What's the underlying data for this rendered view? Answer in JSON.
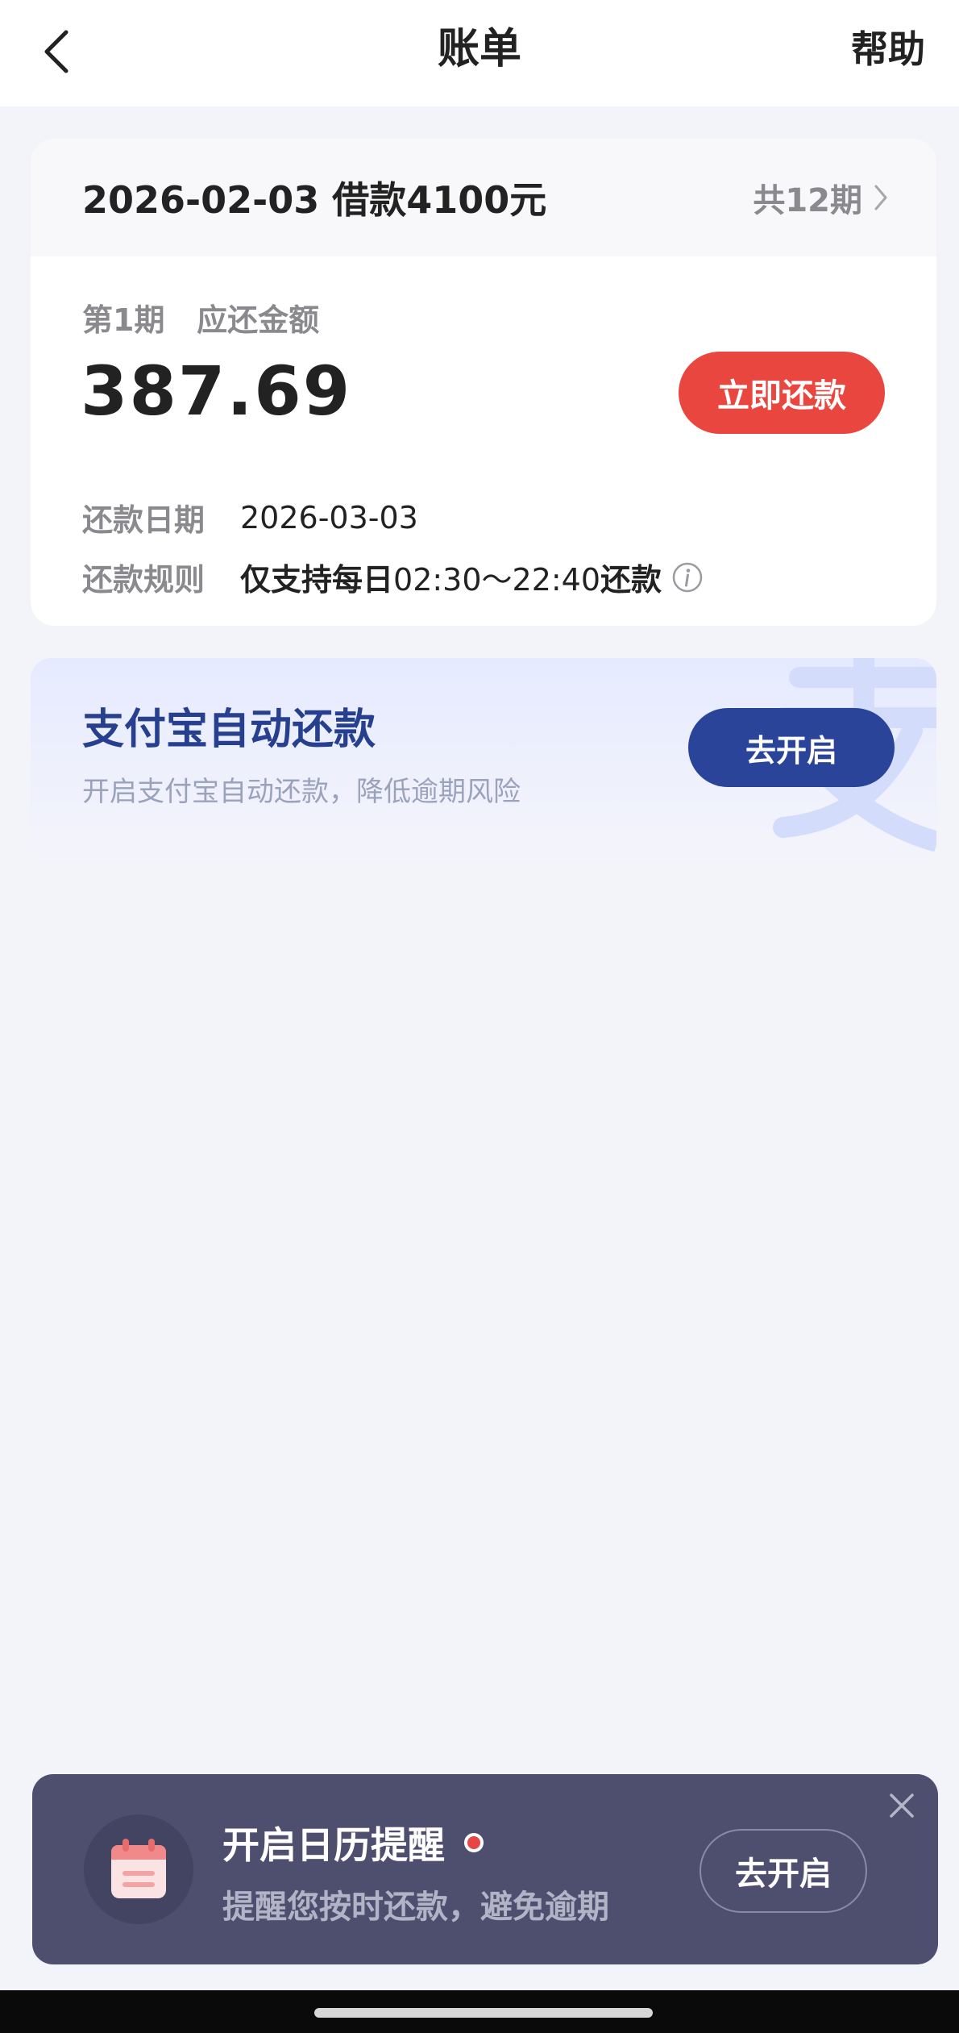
{
  "header": {
    "title": "账单",
    "help_label": "帮助",
    "back_icon": "chevron-left-icon"
  },
  "loan": {
    "summary": "2026-02-03 借款4100元",
    "periods_label": "共12期",
    "period_label": "第1期   应还金额",
    "amount": "387.69",
    "repay_button": "立即还款",
    "date_label": "还款日期",
    "date_value": "2026-03-03",
    "rule_label": "还款规则",
    "rule_prefix": "仅支持每日",
    "rule_time": "02:30～22:40",
    "rule_suffix": "还款",
    "accent_color": "#e9463f"
  },
  "alipay": {
    "title": "支付宝自动还款",
    "subtitle": "开启支付宝自动还款，降低逾期风险",
    "button": "去开启",
    "brand_color": "#2a4499"
  },
  "reminder": {
    "title": "开启日历提醒",
    "subtitle": "提醒您按时还款，避免逾期",
    "button": "去开启",
    "icon": "calendar-icon"
  }
}
